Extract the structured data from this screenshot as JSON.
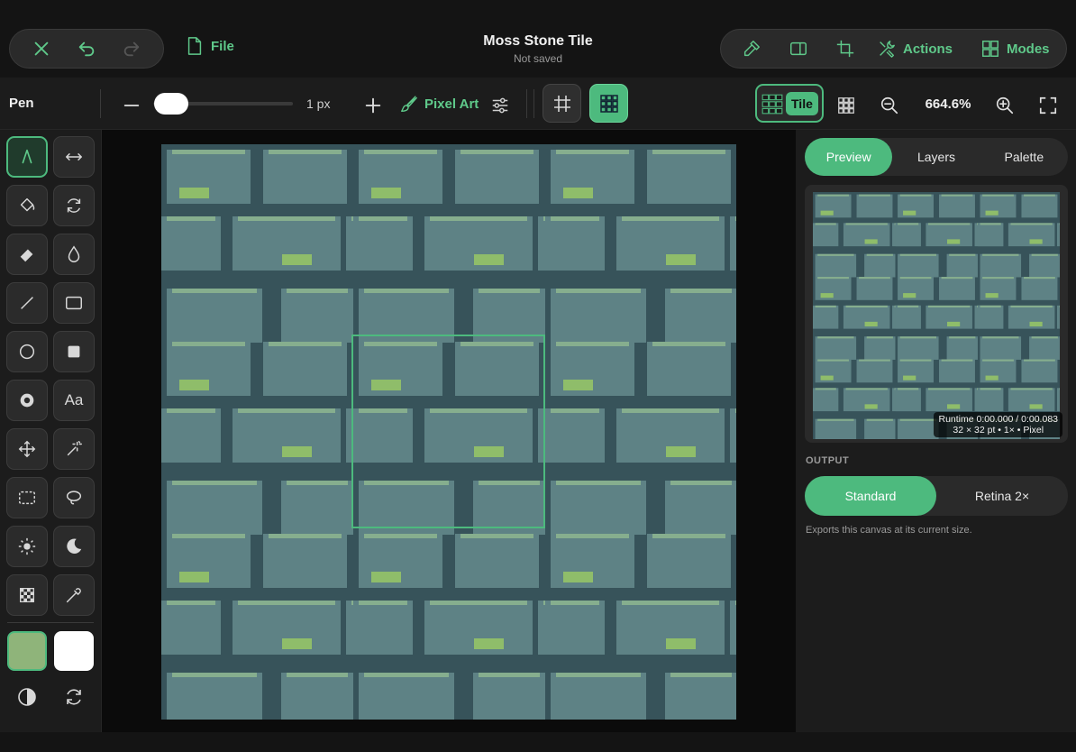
{
  "header": {
    "title": "Moss Stone Tile",
    "subtitle": "Not saved",
    "file_label": "File",
    "actions_label": "Actions",
    "modes_label": "Modes"
  },
  "toolbar": {
    "tool_name": "Pen",
    "brush_size": "1 px",
    "brush_size_fraction": 0.12,
    "pixel_art_label": "Pixel Art",
    "tile_label": "Tile",
    "zoom": "664.6%"
  },
  "tools": [
    "pen",
    "mirror",
    "fill",
    "rotate",
    "eraser",
    "blur-drop",
    "line",
    "rectangle",
    "ellipse",
    "filled-rectangle",
    "radial",
    "text",
    "move",
    "magic-wand",
    "rect-select",
    "lasso-select",
    "lighten",
    "darken",
    "checker-pattern",
    "eyedropper"
  ],
  "text_tool_label": "Aa",
  "colors": {
    "accent": "#4dba7e",
    "primary_swatch": "#8fb47a",
    "secondary_swatch": "#ffffff",
    "tile_mortar": "#37535a",
    "tile_stone": "#5e8285",
    "tile_highlight": "#86ae8e",
    "tile_moss": "#8fbd6a"
  },
  "panel": {
    "tabs": [
      "Preview",
      "Layers",
      "Palette"
    ],
    "active_tab": "Preview",
    "runtime_line1": "Runtime 0:00.000 / 0:00.083",
    "runtime_line2": "32 × 32 pt • 1× • Pixel",
    "output_heading": "OUTPUT",
    "output_options": [
      "Standard",
      "Retina 2×"
    ],
    "active_output": "Standard",
    "export_note": "Exports this canvas at its current size."
  }
}
